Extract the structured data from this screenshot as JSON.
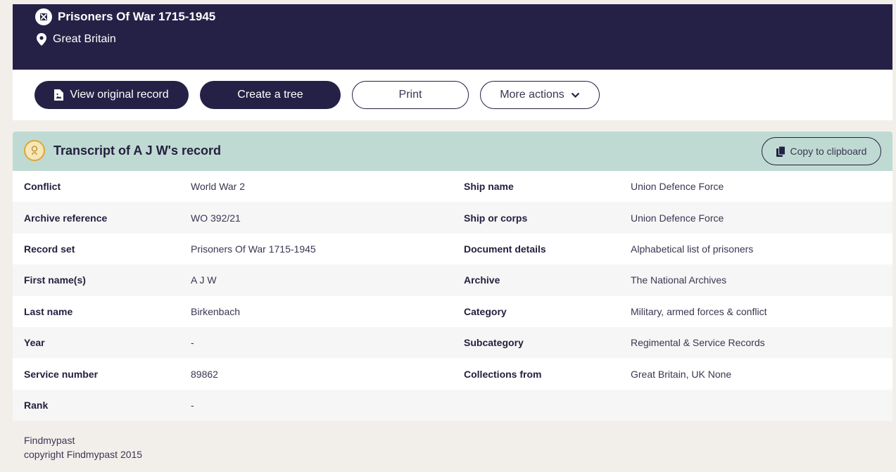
{
  "header": {
    "record_set_title": "Prisoners Of War 1715-1945",
    "location": "Great Britain",
    "bg_color": "#252146"
  },
  "actions": {
    "view_original": "View original record",
    "create_tree": "Create a tree",
    "print": "Print",
    "more_actions": "More actions"
  },
  "transcript": {
    "title": "Transcript of A J W's record",
    "copy_label": "Copy to clipboard",
    "header_color": "#bfdad2"
  },
  "record": {
    "rows": [
      {
        "k1": "Conflict",
        "v1": "World War 2",
        "k2": "Ship name",
        "v2": "Union Defence Force"
      },
      {
        "k1": "Archive reference",
        "v1": "WO 392/21",
        "k2": "Ship or corps",
        "v2": "Union Defence Force"
      },
      {
        "k1": "Record set",
        "v1": "Prisoners Of War 1715-1945",
        "k2": "Document details",
        "v2": "Alphabetical list of prisoners"
      },
      {
        "k1": "First name(s)",
        "v1": "A J W",
        "k2": "Archive",
        "v2": "The National Archives"
      },
      {
        "k1": "Last name",
        "v1": "Birkenbach",
        "k2": "Category",
        "v2": "Military, armed forces & conflict"
      },
      {
        "k1": "Year",
        "v1": "-",
        "k2": "Subcategory",
        "v2": "Regimental & Service Records"
      },
      {
        "k1": "Service number",
        "v1": "89862",
        "k2": "Collections from",
        "v2": "Great Britain, UK None"
      },
      {
        "k1": "Rank",
        "v1": "-",
        "k2": "",
        "v2": ""
      }
    ]
  },
  "footer": {
    "line1": "Findmypast",
    "line2": "copyright Findmypast 2015"
  }
}
